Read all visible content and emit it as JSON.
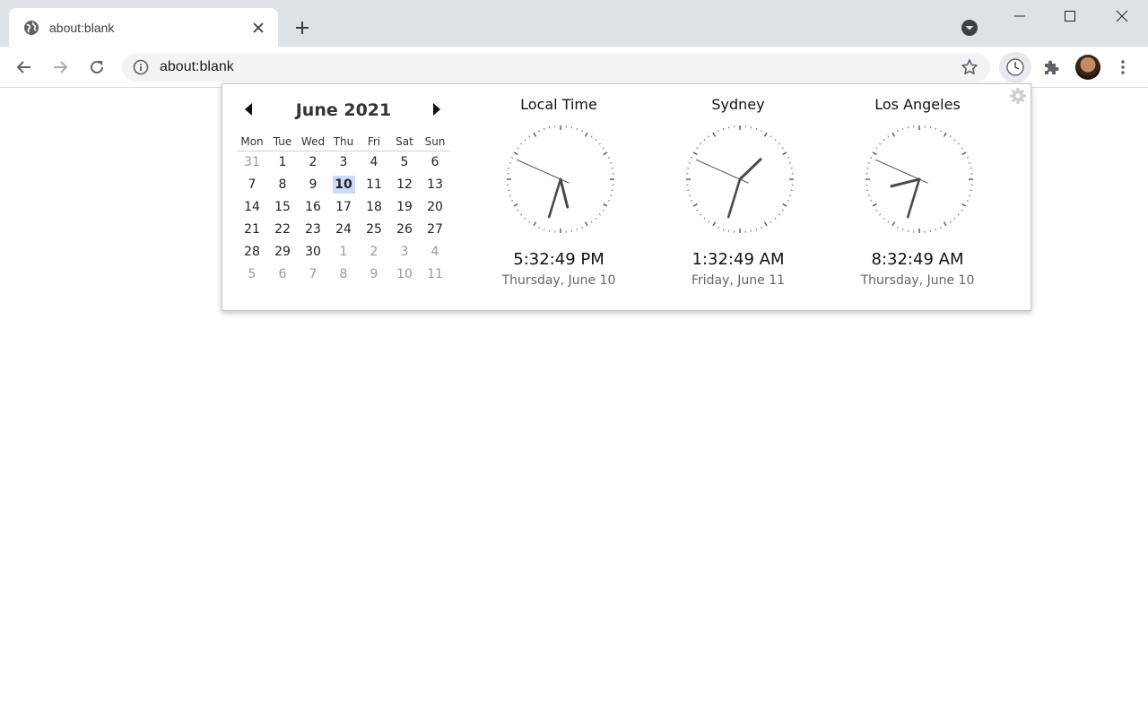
{
  "tab": {
    "title": "about:blank"
  },
  "omnibox": {
    "url": "about:blank"
  },
  "calendar": {
    "month_title": "June 2021",
    "weekdays": [
      "Mon",
      "Tue",
      "Wed",
      "Thu",
      "Fri",
      "Sat",
      "Sun"
    ],
    "weeks": [
      [
        "31",
        "1",
        "2",
        "3",
        "4",
        "5",
        "6"
      ],
      [
        "7",
        "8",
        "9",
        "10",
        "11",
        "12",
        "13"
      ],
      [
        "14",
        "15",
        "16",
        "17",
        "18",
        "19",
        "20"
      ],
      [
        "21",
        "22",
        "23",
        "24",
        "25",
        "26",
        "27"
      ],
      [
        "28",
        "29",
        "30",
        "1",
        "2",
        "3",
        "4"
      ],
      [
        "5",
        "6",
        "7",
        "8",
        "9",
        "10",
        "11"
      ]
    ],
    "today": "10"
  },
  "clocks": [
    {
      "label": "Local Time",
      "time": "5:32:49 PM",
      "date": "Thursday, June 10",
      "hour": 17,
      "minute": 32,
      "second": 49
    },
    {
      "label": "Sydney",
      "time": "1:32:49 AM",
      "date": "Friday, June 11",
      "hour": 1,
      "minute": 32,
      "second": 49
    },
    {
      "label": "Los Angeles",
      "time": "8:32:49 AM",
      "date": "Thursday, June 10",
      "hour": 8,
      "minute": 32,
      "second": 49
    }
  ],
  "colors": {
    "today_highlight": "#c9dcf7",
    "hand": "#4a4a4a",
    "tick": "#555555"
  },
  "icons": {
    "favicon": "globe-icon",
    "tab_close": "close-icon",
    "new_tab": "plus-icon",
    "tab_search": "chevron-down-circle-icon",
    "back": "back-arrow-icon",
    "forward": "forward-arrow-icon",
    "reload": "reload-icon",
    "info": "info-icon",
    "star": "star-icon",
    "extension": "clock-icon",
    "extensions": "puzzle-icon",
    "menu": "kebab-menu-icon",
    "settings": "gear-icon"
  }
}
